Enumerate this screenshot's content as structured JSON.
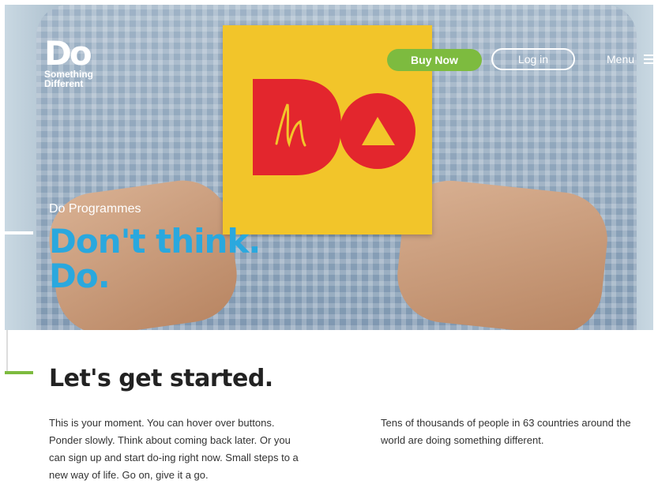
{
  "brand": {
    "logo_text": "Do",
    "tagline_line1": "Something",
    "tagline_line2": "Different"
  },
  "header": {
    "buy_label": "Buy Now",
    "login_label": "Log in",
    "menu_label": "Menu",
    "menu_icon": "hamburger-icon"
  },
  "hero": {
    "eyebrow": "Do Programmes",
    "title_line1": "Don't think.",
    "title_line2": "Do."
  },
  "content": {
    "heading": "Let's get started.",
    "col1": "This is your moment. You can hover over buttons. Ponder slowly. Think about coming back later. Or you can sign up and start do-ing right now. Small steps to a new way of life. Go on, give it a go.",
    "col2": "Tens of thousands of people in 63 countries around the world are doing something different."
  },
  "colors": {
    "accent_blue": "#2aa8de",
    "accent_green": "#7dbb3f",
    "sticky_yellow": "#f2c52a",
    "logo_red": "#e3262d"
  }
}
